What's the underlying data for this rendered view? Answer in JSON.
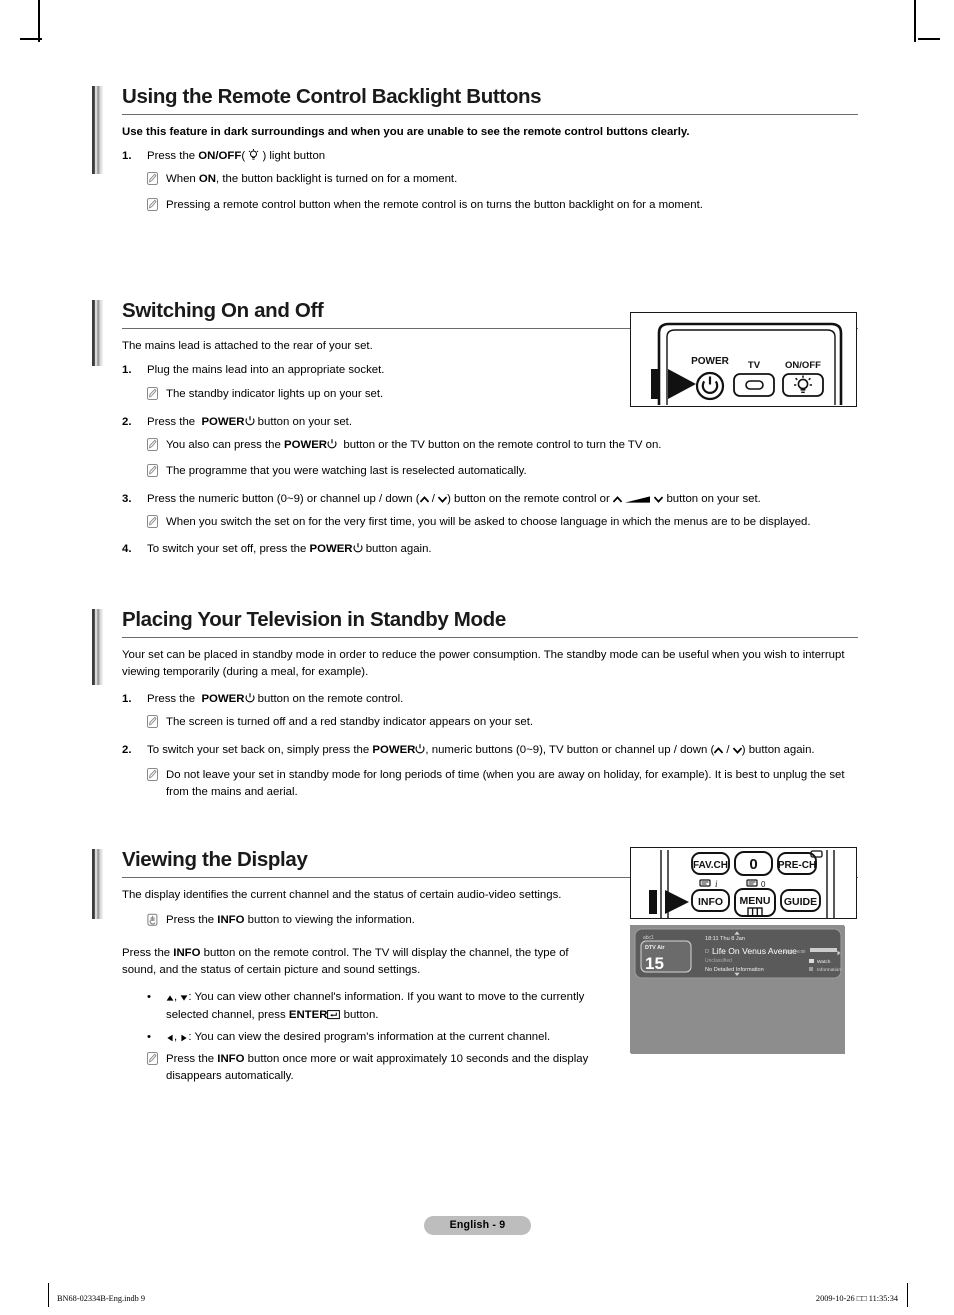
{
  "document": {
    "page_label": "English - 9",
    "footer_left": "BN68-02334B-Eng.indb   9",
    "footer_right": "2009-10-26   □□ 11:35:34"
  },
  "sections": [
    {
      "id": "remote-backlight",
      "title": "Using the Remote Control Backlight Buttons",
      "lead_bold": "Use this feature in dark surroundings and when you are unable to see the remote control buttons clearly.",
      "steps": [
        {
          "num": "1.",
          "text_prefix": "Press the ",
          "bold": "ON/OFF",
          "text_suffix": "( ☀ ) light button"
        }
      ],
      "notes": [
        "When ON, the button backlight is turned on for a moment.",
        "Pressing a remote control button when the remote control is on turns the button backlight on for a moment."
      ]
    },
    {
      "id": "switching-on-off",
      "title": "Switching On and Off",
      "lead": "The mains lead is attached to the rear of your set.",
      "items": [
        {
          "kind": "step",
          "num": "1.",
          "text": "Plug the mains lead into an appropriate socket."
        },
        {
          "kind": "note",
          "text": "The standby indicator lights up on your set."
        },
        {
          "kind": "step",
          "num": "2.",
          "text": "Press the  POWER ⏻ button on your set."
        },
        {
          "kind": "note",
          "text": "You also can press the POWER ⏻  button or the TV button on the remote control to turn the TV on."
        },
        {
          "kind": "note",
          "text": "The programme that you were watching last is reselected automatically."
        },
        {
          "kind": "step",
          "num": "3.",
          "text": "Press the numeric button (0~9) or channel up / down ( ∧ / ∨ ) button on the remote control or ∧  ◥  ∨ button on your set."
        },
        {
          "kind": "note",
          "text": "When you switch the set on for the very first time, you will be asked to choose language in which the menus are to be displayed."
        },
        {
          "kind": "step",
          "num": "4.",
          "text": "To switch your set off, press the POWER ⏻ button again."
        }
      ]
    },
    {
      "id": "standby-mode",
      "title": "Placing Your Television in Standby Mode",
      "lead": "Your set can be placed in standby mode in order to reduce the power consumption. The standby mode can be useful when you wish to interrupt viewing temporarily (during a meal, for example).",
      "items": [
        {
          "kind": "step",
          "num": "1.",
          "text": "Press the  POWER ⏻ button on the remote control."
        },
        {
          "kind": "note",
          "text": "The screen is turned off and a red standby indicator appears on your set."
        },
        {
          "kind": "step",
          "num": "2.",
          "text": "To switch your set back on, simply press the POWER ⏻, numeric buttons (0~9), TV button or channel up / down ( ∧ / ∨ ) button again."
        },
        {
          "kind": "note",
          "text": "Do not leave your set in standby mode for long periods of time (when you are away on holiday, for example). It is best to unplug the set from the mains and aerial."
        }
      ]
    },
    {
      "id": "viewing-display",
      "title": "Viewing the Display",
      "lead": "The display identifies the current channel and the status of certain audio-video settings.",
      "press_note": "Press the INFO button to viewing the information.",
      "paragraph": "Press the INFO button on the remote control. The TV will display the channel, the type of sound, and the status of certain picture and sound settings.",
      "bullets": [
        "▲, ▼: You can view other channel's information. If you want to move to the currently selected channel, press ENTER ↵ button.",
        "◀, ▶: You can view the desired program's information at the current channel."
      ],
      "final_note": "Press the INFO button once more or wait approximately 10 seconds and the display disappears automatically."
    }
  ],
  "figures": {
    "remote_power": {
      "labels": {
        "power": "POWER",
        "tv": "TV",
        "onoff": "ON/OFF"
      }
    },
    "remote_info": {
      "row1": [
        "FAV.CH",
        "0",
        "PRE-CH"
      ],
      "row2": [
        "INFO",
        "MENU",
        "GUIDE"
      ]
    },
    "osd": {
      "service_name": "abc1",
      "source": "DTV Air",
      "channel_number": "15",
      "clock": "18:11 Thu 8 Jan",
      "programme_title": "Life On Venus Avenue",
      "rating": "Unclassified",
      "detail": "No Detailed Information",
      "time_range": "18:00 - 6:00",
      "action_watch": "Watch",
      "action_information": "Information",
      "background_color": "#8d8d8d",
      "panel_color": "#5d5d5d"
    }
  }
}
